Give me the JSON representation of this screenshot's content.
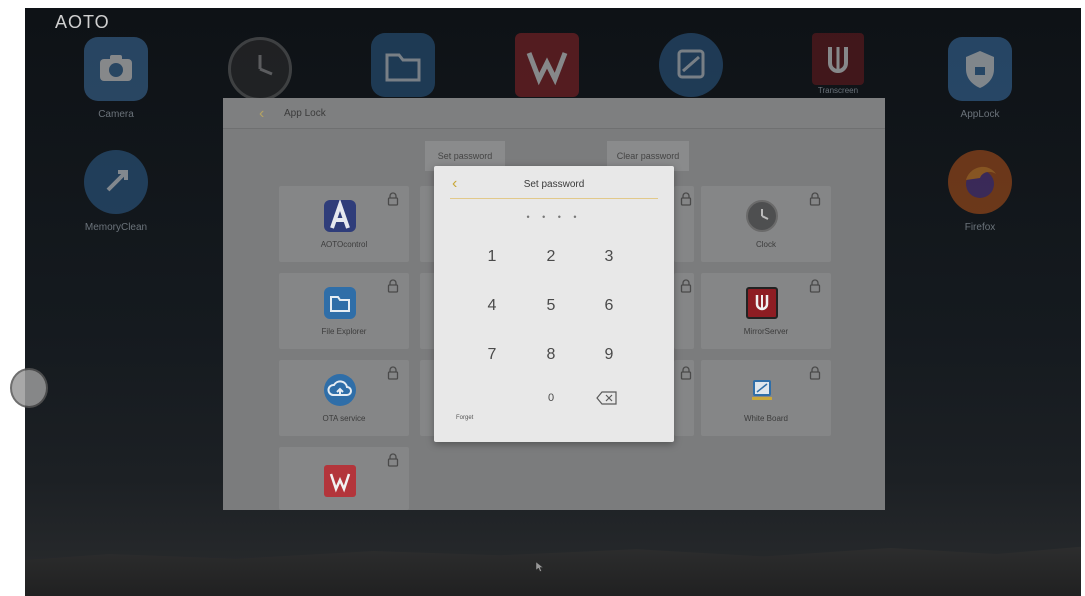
{
  "brand": "AOTO",
  "desktop": {
    "icons": [
      {
        "name": "camera",
        "label": "Camera"
      },
      {
        "name": "clock",
        "label": ""
      },
      {
        "name": "folder",
        "label": ""
      },
      {
        "name": "wps",
        "label": ""
      },
      {
        "name": "whiteboard",
        "label": ""
      },
      {
        "name": "transcreen",
        "label": "Transcreen"
      },
      {
        "name": "applock",
        "label": "AppLock"
      },
      {
        "name": "memoryclean",
        "label": "MemoryClean"
      },
      {
        "name": "firefox",
        "label": "Firefox"
      }
    ]
  },
  "app_lock": {
    "title": "App Lock",
    "set_password_button": "Set password",
    "clear_password_button": "Clear password",
    "apps": [
      {
        "label": "AOTOcontrol",
        "icon": "aoto-a-icon"
      },
      {
        "label": "Clock",
        "icon": "clock-icon"
      },
      {
        "label": "File Explorer",
        "icon": "folder-icon"
      },
      {
        "label": "MirrorServer",
        "icon": "transcreen-icon"
      },
      {
        "label": "OTA service",
        "icon": "cloud-upload-icon"
      },
      {
        "label": "White Board",
        "icon": "whiteboard-icon"
      },
      {
        "label": "",
        "icon": "wps-icon"
      }
    ]
  },
  "dialog": {
    "title": "Set password",
    "entered_dots": "• • • •",
    "keys": [
      "1",
      "2",
      "3",
      "4",
      "5",
      "6",
      "7",
      "8",
      "9",
      "0"
    ],
    "forget_label": "Forget"
  },
  "colors": {
    "accent": "#c9a83a",
    "panel_bg": "#7b7c7d",
    "dialog_bg": "#e8e8e8",
    "wps_red": "#c8343b",
    "icon_blue": "#2f6ea8"
  }
}
